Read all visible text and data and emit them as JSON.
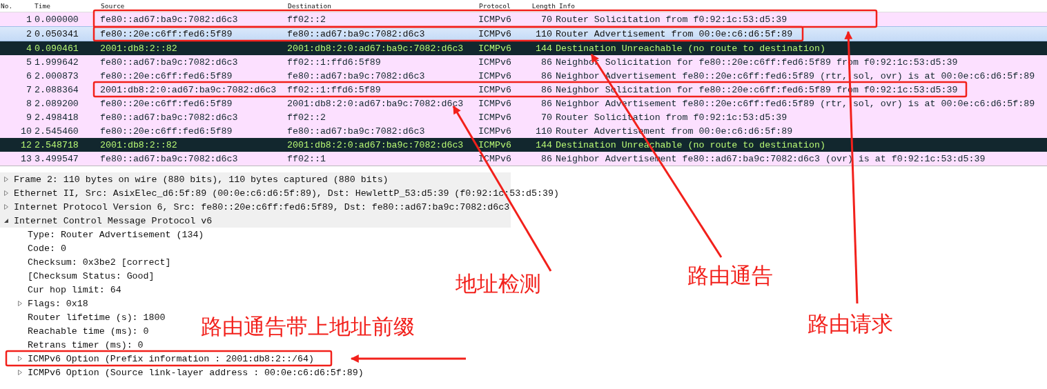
{
  "packet_list": {
    "columns": [
      "No.",
      "Time",
      "Source",
      "Destination",
      "Protocol",
      "Length",
      "Info"
    ],
    "rows": [
      {
        "no": "1",
        "time": "0.000000",
        "source": "fe80::ad67:ba9c:7082:d6c3",
        "destination": "ff02::2",
        "protocol": "ICMPv6",
        "length": "70",
        "info": "Router Solicitation from f0:92:1c:53:d5:39",
        "kind": "icmp",
        "selected": false
      },
      {
        "no": "2",
        "time": "0.050341",
        "source": "fe80::20e:c6ff:fed6:5f89",
        "destination": "fe80::ad67:ba9c:7082:d6c3",
        "protocol": "ICMPv6",
        "length": "110",
        "info": "Router Advertisement from 00:0e:c6:d6:5f:89",
        "kind": "icmp",
        "selected": true
      },
      {
        "no": "4",
        "time": "0.090461",
        "source": "2001:db8:2::82",
        "destination": "2001:db8:2:0:ad67:ba9c:7082:d6c3",
        "protocol": "ICMPv6",
        "length": "144",
        "info": "Destination Unreachable (no route to destination)",
        "kind": "icmp_error",
        "selected": false
      },
      {
        "no": "5",
        "time": "1.999642",
        "source": "fe80::ad67:ba9c:7082:d6c3",
        "destination": "ff02::1:ffd6:5f89",
        "protocol": "ICMPv6",
        "length": "86",
        "info": "Neighbor Solicitation for fe80::20e:c6ff:fed6:5f89 from f0:92:1c:53:d5:39",
        "kind": "icmp",
        "selected": false
      },
      {
        "no": "6",
        "time": "2.000873",
        "source": "fe80::20e:c6ff:fed6:5f89",
        "destination": "fe80::ad67:ba9c:7082:d6c3",
        "protocol": "ICMPv6",
        "length": "86",
        "info": "Neighbor Advertisement fe80::20e:c6ff:fed6:5f89 (rtr, sol, ovr) is at 00:0e:c6:d6:5f:89",
        "kind": "icmp",
        "selected": false
      },
      {
        "no": "7",
        "time": "2.088364",
        "source": "2001:db8:2:0:ad67:ba9c:7082:d6c3",
        "destination": "ff02::1:ffd6:5f89",
        "protocol": "ICMPv6",
        "length": "86",
        "info": "Neighbor Solicitation for fe80::20e:c6ff:fed6:5f89 from f0:92:1c:53:d5:39",
        "kind": "icmp",
        "selected": false
      },
      {
        "no": "8",
        "time": "2.089200",
        "source": "fe80::20e:c6ff:fed6:5f89",
        "destination": "2001:db8:2:0:ad67:ba9c:7082:d6c3",
        "protocol": "ICMPv6",
        "length": "86",
        "info": "Neighbor Advertisement fe80::20e:c6ff:fed6:5f89 (rtr, sol, ovr) is at 00:0e:c6:d6:5f:89",
        "kind": "icmp",
        "selected": false
      },
      {
        "no": "9",
        "time": "2.498418",
        "source": "fe80::ad67:ba9c:7082:d6c3",
        "destination": "ff02::2",
        "protocol": "ICMPv6",
        "length": "70",
        "info": "Router Solicitation from f0:92:1c:53:d5:39",
        "kind": "icmp",
        "selected": false
      },
      {
        "no": "10",
        "time": "2.545460",
        "source": "fe80::20e:c6ff:fed6:5f89",
        "destination": "fe80::ad67:ba9c:7082:d6c3",
        "protocol": "ICMPv6",
        "length": "110",
        "info": "Router Advertisement from 00:0e:c6:d6:5f:89",
        "kind": "icmp",
        "selected": false
      },
      {
        "no": "12",
        "time": "2.548718",
        "source": "2001:db8:2::82",
        "destination": "2001:db8:2:0:ad67:ba9c:7082:d6c3",
        "protocol": "ICMPv6",
        "length": "144",
        "info": "Destination Unreachable (no route to destination)",
        "kind": "icmp_error",
        "selected": false
      },
      {
        "no": "13",
        "time": "3.499547",
        "source": "fe80::ad67:ba9c:7082:d6c3",
        "destination": "ff02::1",
        "protocol": "ICMPv6",
        "length": "86",
        "info": "Neighbor Advertisement fe80::ad67:ba9c:7082:d6c3 (ovr) is at f0:92:1c:53:d5:39",
        "kind": "icmp",
        "selected": false
      }
    ]
  },
  "packet_details": [
    {
      "text": "Frame 2: 110 bytes on wire (880 bits), 110 bytes captured (880 bits)",
      "expanded": false
    },
    {
      "text": "Ethernet II, Src: AsixElec_d6:5f:89 (00:0e:c6:d6:5f:89), Dst: HewlettP_53:d5:39 (f0:92:1c:53:d5:39)",
      "expanded": false
    },
    {
      "text": "Internet Protocol Version 6, Src: fe80::20e:c6ff:fed6:5f89, Dst: fe80::ad67:ba9c:7082:d6c3",
      "expanded": false
    },
    {
      "text": "Internet Control Message Protocol v6",
      "expanded": true,
      "children": [
        {
          "text": "Type: Router Advertisement (134)"
        },
        {
          "text": "Code: 0"
        },
        {
          "text": "Checksum: 0x3be2 [correct]"
        },
        {
          "text": "[Checksum Status: Good]"
        },
        {
          "text": "Cur hop limit: 64"
        },
        {
          "text": "Flags: 0x18",
          "expanded": false
        },
        {
          "text": "Router lifetime (s): 1800"
        },
        {
          "text": "Reachable time (ms): 0"
        },
        {
          "text": "Retrans timer (ms): 0"
        },
        {
          "text": "ICMPv6 Option (Prefix information : 2001:db8:2::/64)",
          "expanded": false
        },
        {
          "text": "ICMPv6 Option (Source link-layer address : 00:0e:c6:d6:5f:89)",
          "expanded": false
        }
      ]
    }
  ],
  "annotations": [
    {
      "text": "地址检测"
    },
    {
      "text": "路由通告"
    },
    {
      "text": "路由请求"
    },
    {
      "text": "路由通告带上地址前缀"
    }
  ]
}
